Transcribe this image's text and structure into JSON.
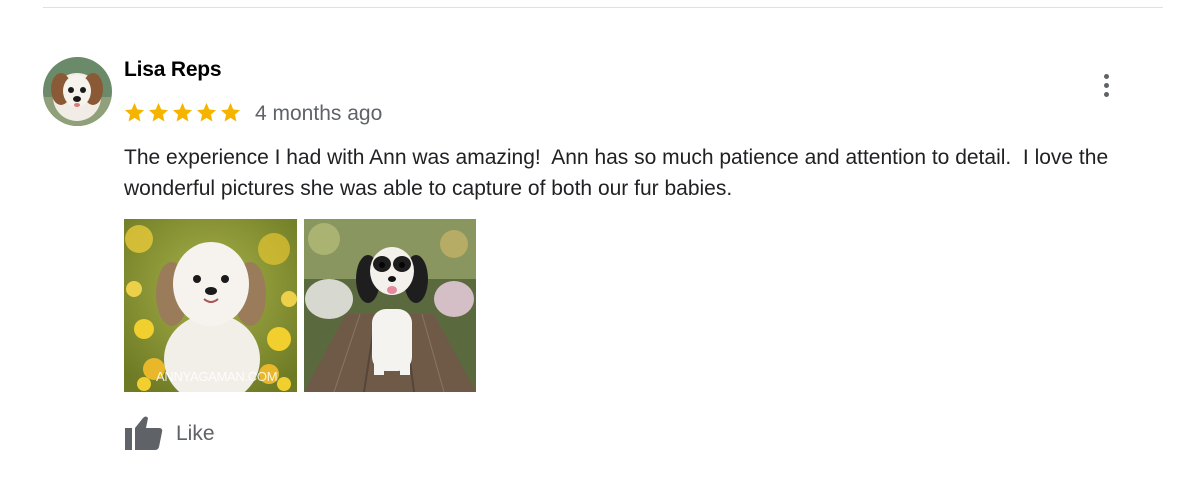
{
  "review": {
    "reviewer_name": "Lisa Reps",
    "rating": 5,
    "rating_max": 5,
    "timestamp": "4 months ago",
    "text": "The experience I had with Ann was amazing!  Ann has so much patience and attention to detail.  I love the wonderful pictures she was able to capture of both our fur babies.",
    "photos": [
      {
        "description": "shih-tzu-in-yellow-flowers",
        "watermark": "ANNYAGAMAN.COM"
      },
      {
        "description": "black-white-dog-on-wooden-bridge",
        "watermark": ""
      }
    ],
    "like_label": "Like"
  },
  "colors": {
    "star": "#f4b400",
    "secondary_text": "#5f6368",
    "primary_text": "#202124",
    "divider": "#e0e0e0"
  },
  "icons": {
    "menu": "more-vert-icon",
    "like": "thumb-up-icon",
    "star": "star-icon"
  }
}
